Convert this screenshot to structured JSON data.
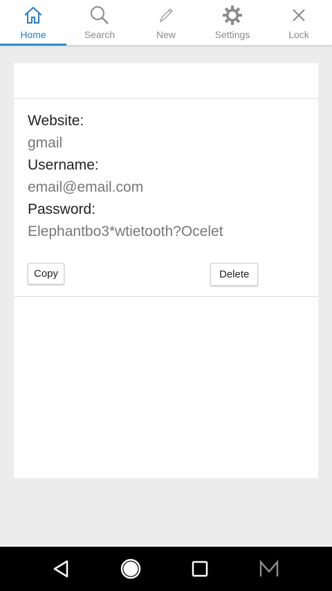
{
  "tabs": [
    {
      "label": "Home",
      "icon": "home-icon",
      "active": true
    },
    {
      "label": "Search",
      "icon": "search-icon",
      "active": false
    },
    {
      "label": "New",
      "icon": "pencil-icon",
      "active": false
    },
    {
      "label": "Settings",
      "icon": "gear-icon",
      "active": false
    },
    {
      "label": "Lock",
      "icon": "close-icon",
      "active": false
    }
  ],
  "entry": {
    "website_label": "Website:",
    "website_value": "gmail",
    "username_label": "Username:",
    "username_value": "email@email.com",
    "password_label": "Password:",
    "password_value": "Elephantbo3*wtietooth?Ocelet"
  },
  "buttons": {
    "copy_label": "Copy",
    "delete_label": "Delete"
  },
  "colors": {
    "accent": "#2b8ad0",
    "background": "#ececec",
    "card": "#ffffff",
    "navbar": "#000000"
  },
  "system_nav": {
    "icons": [
      "back-icon",
      "home-circle-icon",
      "recent-apps-icon",
      "m-logo-icon"
    ]
  }
}
